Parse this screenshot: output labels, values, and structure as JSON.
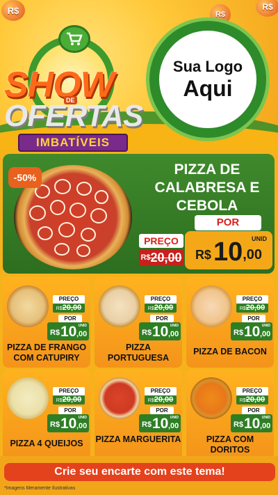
{
  "header": {
    "title_show": "SHOW",
    "title_de": "DE",
    "title_ofertas": "OFERTAS",
    "title_imbativeis": "IMBATÍVEIS",
    "coin_symbol": "R$",
    "logo_line1": "Sua Logo",
    "logo_line2": "Aqui"
  },
  "featured": {
    "discount_badge": "-50%",
    "title": "PIZZA DE CALABRESA E CEBOLA",
    "por_label": "POR",
    "preco_label": "PREÇO",
    "old_currency": "R$",
    "old_price": "20,00",
    "unid_label": "UNID",
    "new_currency": "R$",
    "new_price_int": "10",
    "new_price_dec": ",00"
  },
  "products": [
    {
      "name": "PIZZA DE FRANGO COM CATUPIRY",
      "preco_label": "PREÇO",
      "old_currency": "R$",
      "old_price": "20,00",
      "por_label": "POR",
      "unid_label": "UNID",
      "currency": "R$",
      "price_int": "10",
      "price_dec": ",00"
    },
    {
      "name": "PIZZA PORTUGUESA",
      "preco_label": "PREÇO",
      "old_currency": "R$",
      "old_price": "20,00",
      "por_label": "POR",
      "unid_label": "UNID",
      "currency": "R$",
      "price_int": "10",
      "price_dec": ",00"
    },
    {
      "name": "PIZZA DE BACON",
      "preco_label": "PREÇO",
      "old_currency": "R$",
      "old_price": "20,00",
      "por_label": "POR",
      "unid_label": "UNID",
      "currency": "R$",
      "price_int": "10",
      "price_dec": ",00"
    },
    {
      "name": "PIZZA 4 QUEIJOS",
      "preco_label": "PREÇO",
      "old_currency": "R$",
      "old_price": "20,00",
      "por_label": "POR",
      "unid_label": "UNID",
      "currency": "R$",
      "price_int": "10",
      "price_dec": ",00"
    },
    {
      "name": "PIZZA MARGUERITA",
      "preco_label": "PREÇO",
      "old_currency": "R$",
      "old_price": "20,00",
      "por_label": "POR",
      "unid_label": "UNID",
      "currency": "R$",
      "price_int": "10",
      "price_dec": ",00"
    },
    {
      "name": "PIZZA COM DORITOS",
      "preco_label": "PREÇO",
      "old_currency": "R$",
      "old_price": "20,00",
      "por_label": "POR",
      "unid_label": "UNID",
      "currency": "R$",
      "price_int": "10",
      "price_dec": ",00"
    }
  ],
  "footer": {
    "cta_label": "Crie seu encarte com este tema!",
    "disclaimer": "*Imagens Meramente Ilustrativas"
  },
  "colors": {
    "green": "#2e7e25",
    "orange": "#f5a817",
    "red": "#d8201c",
    "cta": "#e4421d"
  },
  "icons": [
    "cart-icon",
    "coin-icon",
    "pizza-image"
  ]
}
